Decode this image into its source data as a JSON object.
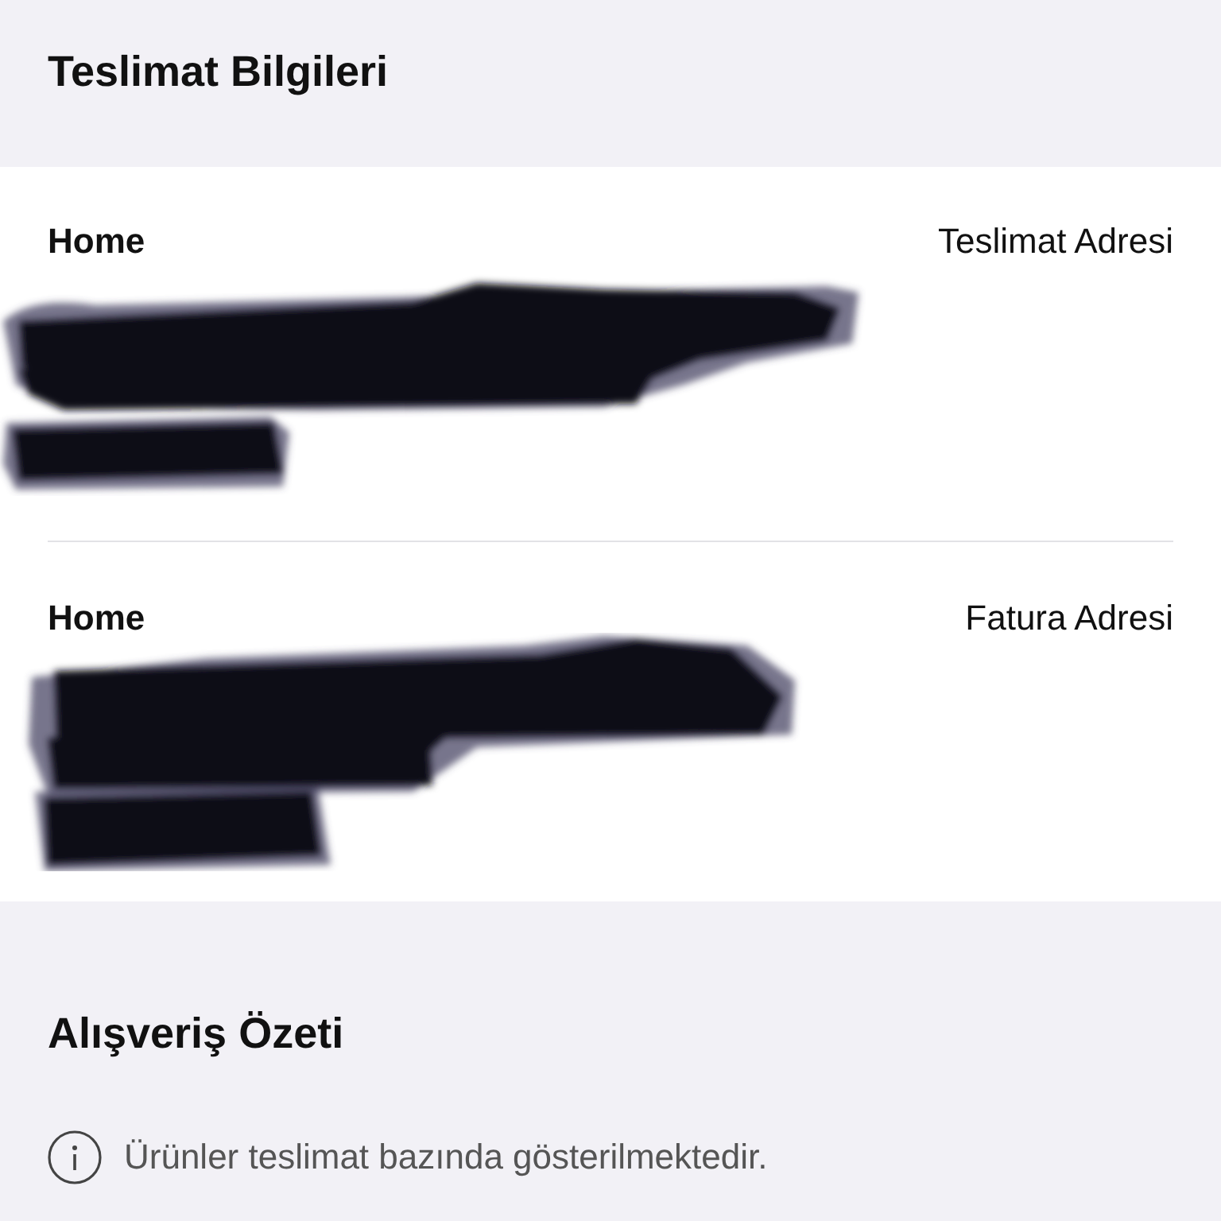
{
  "header": {
    "title": "Teslimat Bilgileri"
  },
  "addresses": [
    {
      "name": "Home",
      "type_label": "Teslimat Adresi",
      "redacted": true
    },
    {
      "name": "Home",
      "type_label": "Fatura Adresi",
      "redacted": true
    }
  ],
  "summary": {
    "title": "Alışveriş Özeti",
    "info_text": "Ürünler teslimat bazında gösterilmektedir."
  }
}
